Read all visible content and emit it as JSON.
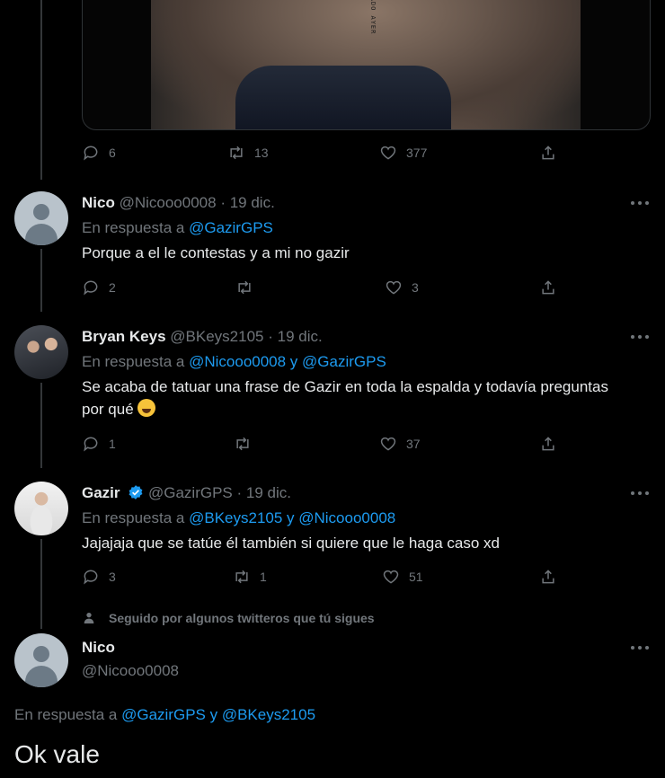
{
  "top_tweet": {
    "media_text": "DORADO AYER",
    "replies": "6",
    "retweets": "13",
    "likes": "377"
  },
  "tweets": [
    {
      "name": "Nico",
      "handle": "@Nicooo0008",
      "date": "19 dic.",
      "reply_prefix": "En respuesta a",
      "reply_to": "@GazirGPS",
      "text": "Porque a el le contestas y a mi no gazir",
      "replies": "2",
      "retweets": "",
      "likes": "3"
    },
    {
      "name": "Bryan Keys",
      "handle": "@BKeys2105",
      "date": "19 dic.",
      "reply_prefix": "En respuesta a",
      "reply_to": "@Nicooo0008 y @GazirGPS",
      "text": "Se acaba de tatuar una frase de Gazir en toda la espalda y todavía preguntas por qué",
      "emoji": "rolling-on-floor-laughing",
      "replies": "1",
      "retweets": "",
      "likes": "37"
    },
    {
      "name": "Gazir",
      "handle": "@GazirGPS",
      "date": "19 dic.",
      "reply_prefix": "En respuesta a",
      "reply_to": "@BKeys2105 y @Nicooo0008",
      "text": "Jajajaja que se tatúe él también si quiere que le haga caso xd",
      "replies": "3",
      "retweets": "1",
      "likes": "51"
    }
  ],
  "social_context": "Seguido por algunos twitteros que tú sigues",
  "main_tweet": {
    "name": "Nico",
    "handle": "@Nicooo0008",
    "reply_prefix": "En respuesta a",
    "reply_to": "@GazirGPS y @BKeys2105",
    "text": "Ok vale"
  },
  "colors": {
    "background": "#000000",
    "text": "#e7e9ea",
    "muted": "#71767b",
    "link": "#1d9bf0",
    "verified": "#1d9bf0"
  }
}
